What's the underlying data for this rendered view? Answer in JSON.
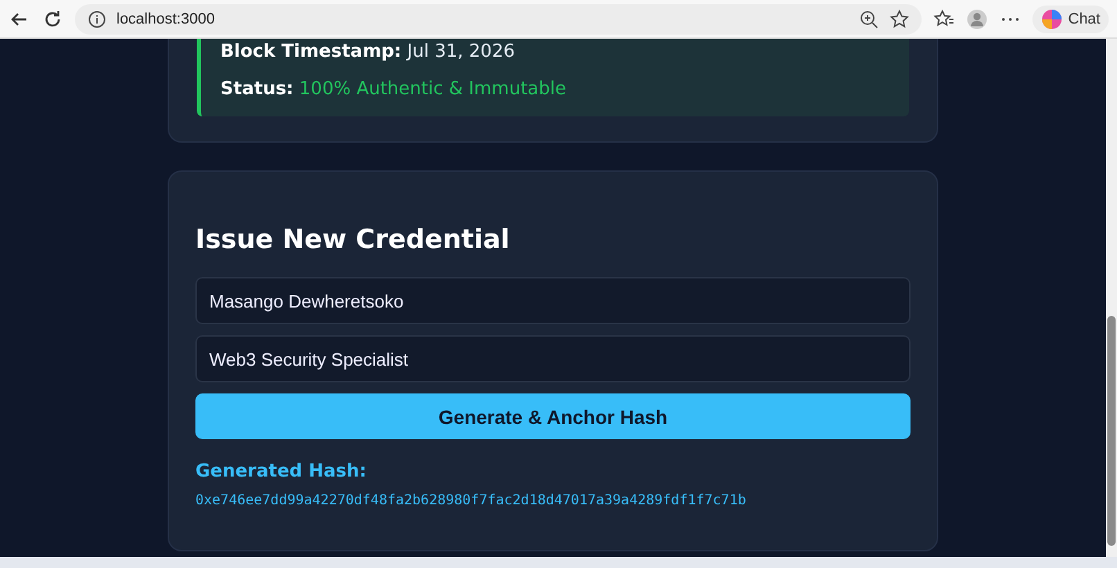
{
  "browser": {
    "url": "localhost:3000",
    "chat_label": "Chat"
  },
  "verification": {
    "fields": [
      {
        "label": "Block Timestamp:",
        "value": "Jul 31, 2026",
        "kind": "plain"
      },
      {
        "label": "Status:",
        "value": "100% Authentic & Immutable",
        "kind": "success"
      }
    ]
  },
  "issue_form": {
    "title": "Issue New Credential",
    "inputs": [
      {
        "value": "Masango Dewheretsoko"
      },
      {
        "value": "Web3 Security Specialist"
      }
    ],
    "button": "Generate & Anchor Hash",
    "result_label": "Generated Hash:",
    "hash": "0xe746ee7dd99a42270df48fa2b628980f7fac2d18d47017a39a4289fdf1f7c71b"
  }
}
